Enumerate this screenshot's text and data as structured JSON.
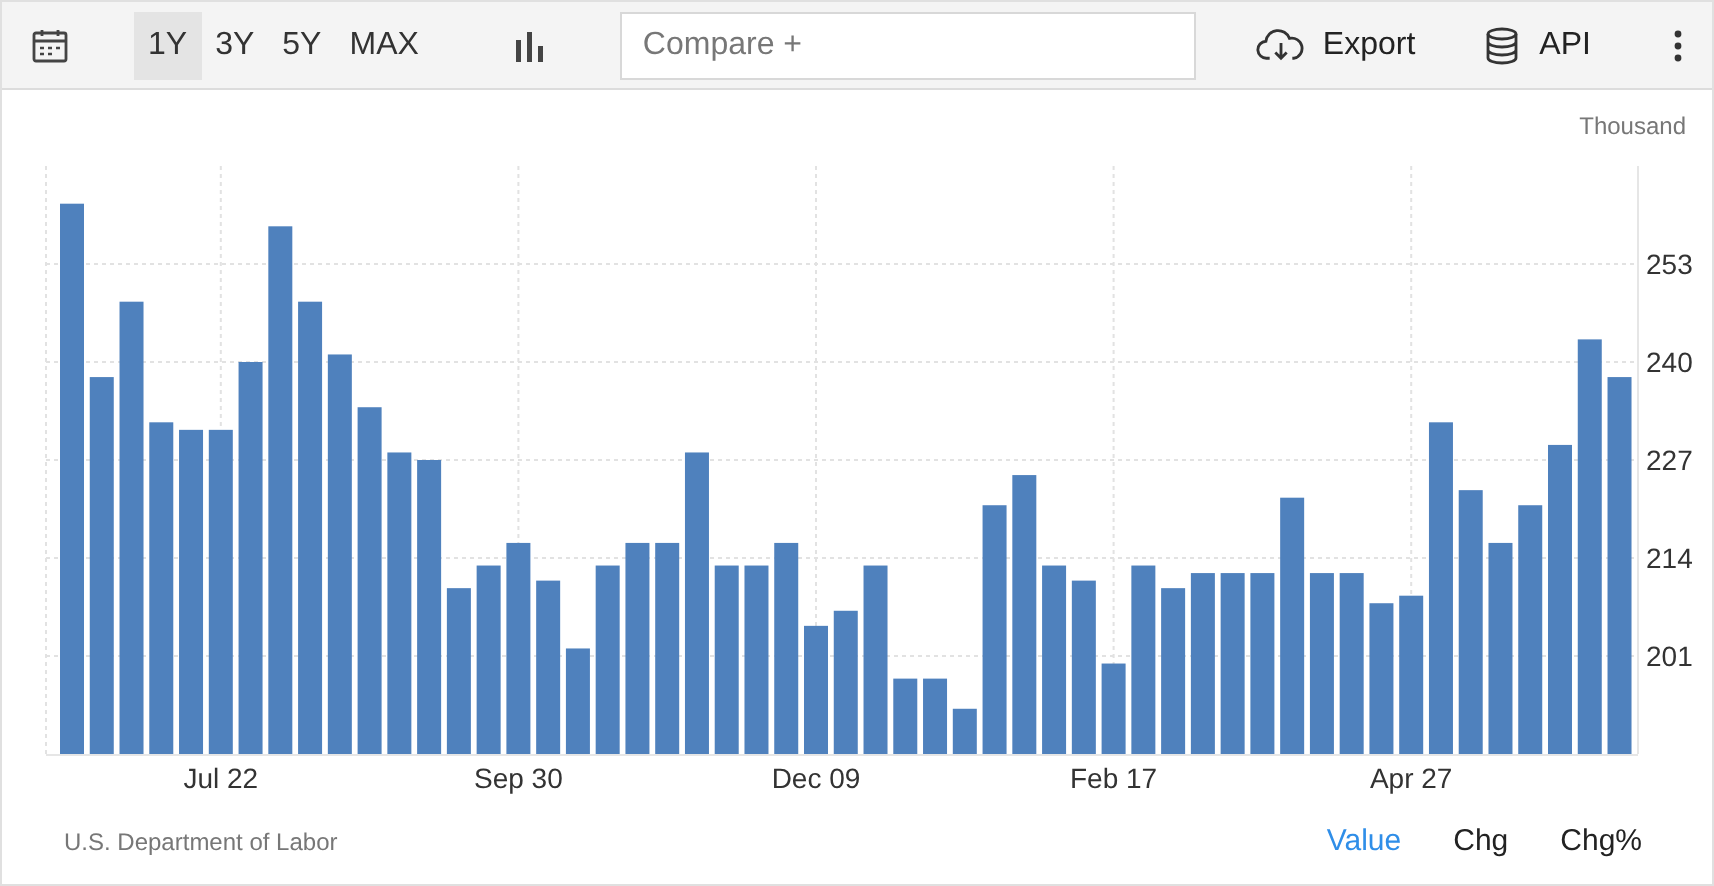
{
  "toolbar": {
    "ranges": [
      {
        "label": "1Y",
        "selected": true
      },
      {
        "label": "3Y",
        "selected": false
      },
      {
        "label": "5Y",
        "selected": false
      },
      {
        "label": "MAX",
        "selected": false
      }
    ],
    "compare": {
      "placeholder": "Compare +"
    },
    "export": "Export",
    "api": "API"
  },
  "chart": {
    "chart_data": {
      "type": "bar",
      "ylabel": "Thousand",
      "categories": [
        null,
        null,
        null,
        null,
        null,
        "Jul 22",
        null,
        null,
        null,
        null,
        null,
        null,
        null,
        null,
        null,
        "Sep 30",
        null,
        null,
        null,
        null,
        null,
        null,
        null,
        null,
        null,
        "Dec 09",
        null,
        null,
        null,
        null,
        null,
        null,
        null,
        null,
        null,
        "Feb 17",
        null,
        null,
        null,
        null,
        null,
        null,
        null,
        null,
        null,
        "Apr 27",
        null,
        null,
        null,
        null,
        null,
        null,
        null
      ],
      "series": [
        {
          "color": "#4f81bd",
          "values": [
            261,
            238,
            248,
            232,
            231,
            231,
            240,
            258,
            248,
            241,
            234,
            228,
            227,
            210,
            213,
            216,
            211,
            202,
            213,
            216,
            216,
            228,
            213,
            213,
            216,
            205,
            207,
            213,
            198,
            198,
            194,
            221,
            225,
            213,
            211,
            200,
            213,
            210,
            212,
            212,
            212,
            222,
            212,
            212,
            208,
            209,
            232,
            223,
            216,
            221,
            229,
            243,
            238
          ]
        }
      ],
      "grid": true,
      "ylim": [
        188,
        266
      ],
      "yticks": [
        201,
        214,
        227,
        240,
        253
      ]
    }
  },
  "footer": {
    "source": "U.S. Department of Labor",
    "views": [
      {
        "label": "Value",
        "selected": true
      },
      {
        "label": "Chg",
        "selected": false
      },
      {
        "label": "Chg%",
        "selected": false
      }
    ]
  }
}
